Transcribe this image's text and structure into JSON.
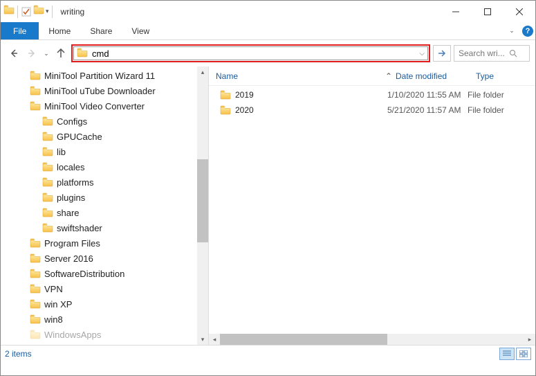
{
  "window": {
    "title": "writing"
  },
  "ribbon": {
    "file": "File",
    "tabs": [
      "Home",
      "Share",
      "View"
    ]
  },
  "addressbar": {
    "value": "cmd"
  },
  "search": {
    "placeholder": "Search wri..."
  },
  "tree": {
    "items": [
      {
        "label": "MiniTool Partition Wizard 11",
        "indent": 1
      },
      {
        "label": "MiniTool uTube Downloader",
        "indent": 1
      },
      {
        "label": "MiniTool Video Converter",
        "indent": 1
      },
      {
        "label": "Configs",
        "indent": 2
      },
      {
        "label": "GPUCache",
        "indent": 2
      },
      {
        "label": "lib",
        "indent": 2
      },
      {
        "label": "locales",
        "indent": 2
      },
      {
        "label": "platforms",
        "indent": 2
      },
      {
        "label": "plugins",
        "indent": 2
      },
      {
        "label": "share",
        "indent": 2
      },
      {
        "label": "swiftshader",
        "indent": 2
      },
      {
        "label": "Program Files",
        "indent": 1
      },
      {
        "label": "Server 2016",
        "indent": 1
      },
      {
        "label": "SoftwareDistribution",
        "indent": 1
      },
      {
        "label": "VPN",
        "indent": 1
      },
      {
        "label": "win XP",
        "indent": 1
      },
      {
        "label": "win8",
        "indent": 1
      },
      {
        "label": "WindowsApps",
        "indent": 1,
        "partial": true
      }
    ]
  },
  "columns": {
    "name": "Name",
    "date": "Date modified",
    "type": "Type"
  },
  "files": [
    {
      "name": "2019",
      "date": "1/10/2020 11:55 AM",
      "type": "File folder"
    },
    {
      "name": "2020",
      "date": "5/21/2020 11:57 AM",
      "type": "File folder"
    }
  ],
  "status": {
    "count": "2 items"
  }
}
